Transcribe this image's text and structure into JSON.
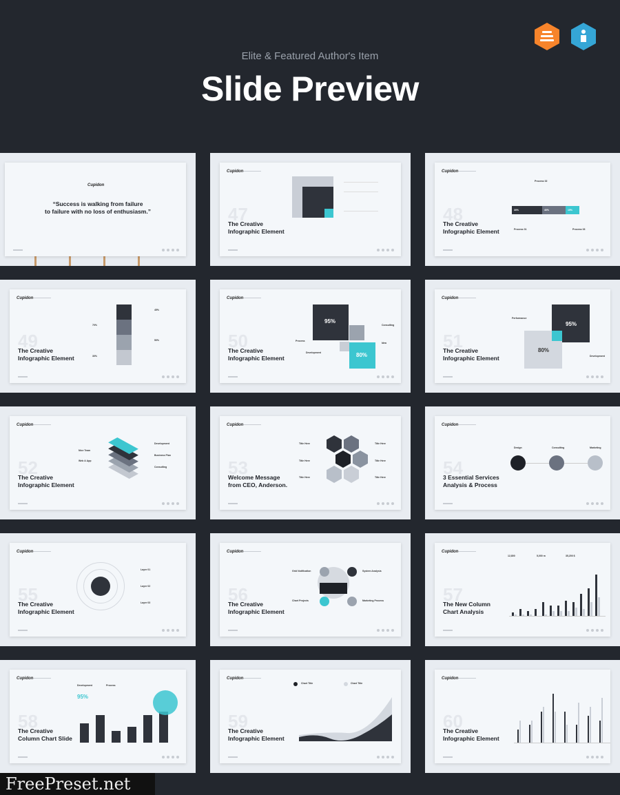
{
  "header": {
    "subtitle": "Elite & Featured Author's Item",
    "title": "Slide Preview"
  },
  "badges": [
    {
      "icon": "elite-author-icon",
      "color": "#f7842b"
    },
    {
      "icon": "featured-author-icon",
      "color": "#35a6d6"
    }
  ],
  "colors": {
    "dark": "#2f333b",
    "accent": "#3cc6d0",
    "mid": "#6b7280",
    "light": "#b8bfc9"
  },
  "logo": "Cupidon",
  "slides": [
    {
      "num": "",
      "title": "“Success is walking from failure\nto failure with no loss of enthusiasm.”"
    },
    {
      "num": "47",
      "title": "The Creative\nInfographic Element"
    },
    {
      "num": "48",
      "title": "The Creative\nInfographic Element",
      "labels": [
        "Process 02",
        "Process 01",
        "Process 03",
        "30%",
        "40%",
        "15%"
      ]
    },
    {
      "num": "49",
      "title": "The Creative\nInfographic Element",
      "labels": [
        "45%",
        "70%",
        "50%",
        "30%"
      ]
    },
    {
      "num": "50",
      "title": "The Creative\nInfographic Element",
      "labels": [
        "95%",
        "80%",
        "Consulting",
        "Process",
        "Idea",
        "Development"
      ]
    },
    {
      "num": "51",
      "title": "The Creative\nInfographic Element",
      "labels": [
        "95%",
        "80%",
        "Performance",
        "Development"
      ]
    },
    {
      "num": "52",
      "title": "The Creative\nInfographic Element",
      "labels": [
        "Development",
        "Business Plan",
        "Consulting",
        "Nice Team",
        "Web & App"
      ]
    },
    {
      "num": "53",
      "title": "Welcome Message\nfrom CEO, Anderson.",
      "labels": [
        "Title Here",
        "Title Here",
        "Title Here",
        "Title Here",
        "Title Here",
        "Title Here"
      ]
    },
    {
      "num": "54",
      "title": "3 Essential Services\nAnalysis & Process",
      "labels": [
        "Design",
        "Consulting",
        "Marketing"
      ]
    },
    {
      "num": "55",
      "title": "The Creative\nInfographic Element",
      "labels": [
        "Layer 01",
        "Layer 02",
        "Layer 03"
      ]
    },
    {
      "num": "56",
      "title": "The Creative\nInfographic Element",
      "labels": [
        "Grid Notification",
        "System Analysis",
        "Chart Projects",
        "Marketing Process"
      ]
    },
    {
      "num": "57",
      "title": "The New Column\nChart Analysis",
      "labels": [
        "12,800",
        "5,000 m",
        "35,200 $"
      ]
    },
    {
      "num": "58",
      "title": "The Creative\nColumn Chart Slide",
      "labels": [
        "Development",
        "Process",
        "95%"
      ]
    },
    {
      "num": "59",
      "title": "The Creative\nInfographic Element",
      "labels": [
        "Chart Title",
        "Chart Title"
      ]
    },
    {
      "num": "60",
      "title": "The Creative\nInfographic Element"
    }
  ],
  "chart57": {
    "dark": [
      2,
      4,
      3,
      4,
      8,
      6,
      6,
      9,
      8,
      13,
      16,
      24
    ],
    "light": [
      1,
      1,
      1,
      0,
      1,
      3,
      3,
      3,
      5,
      4,
      8,
      11
    ]
  },
  "chart58": [
    5,
    7,
    3,
    4,
    7,
    8
  ],
  "chart60": {
    "dark": [
      3,
      4,
      7,
      11,
      7,
      4,
      6,
      5
    ],
    "light": [
      5,
      5,
      8,
      7,
      4,
      9,
      8,
      10
    ]
  },
  "watermark": "FreePreset.net"
}
